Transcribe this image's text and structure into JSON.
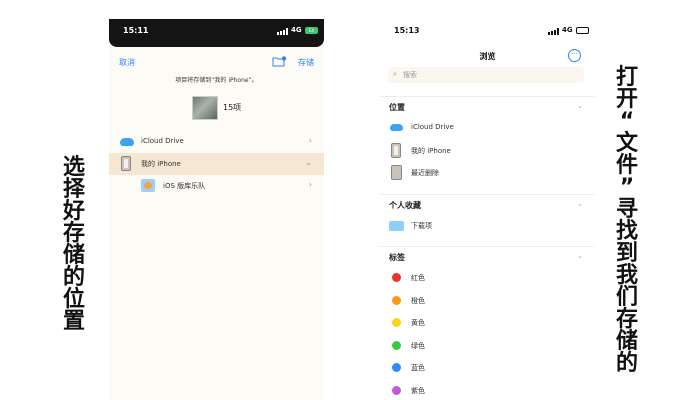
{
  "left_phone": {
    "status": {
      "time": "15:11",
      "network": "4G",
      "battery": "EX"
    },
    "nav": {
      "cancel": "取消",
      "save": "存储"
    },
    "hint": "项目将存储到“我的 iPhone”。",
    "item_count": "15项",
    "locations": [
      {
        "label": "iCloud Drive"
      },
      {
        "label": "我的 iPhone"
      },
      {
        "label": "iOS 版库乐队"
      }
    ]
  },
  "right_phone": {
    "status": {
      "time": "15:13",
      "network": "4G"
    },
    "title": "浏览",
    "more": "···",
    "search_placeholder": "搜索",
    "sections": {
      "locations": {
        "title": "位置",
        "items": [
          "iCloud Drive",
          "我的 iPhone",
          "最近删除"
        ]
      },
      "favorites": {
        "title": "个人收藏",
        "items": [
          "下载项"
        ]
      },
      "tags": {
        "title": "标签",
        "items": [
          {
            "label": "红色",
            "color": "#e8342b"
          },
          {
            "label": "橙色",
            "color": "#f59a1b"
          },
          {
            "label": "黄色",
            "color": "#f8d51c"
          },
          {
            "label": "绿色",
            "color": "#3cc846"
          },
          {
            "label": "蓝色",
            "color": "#2f8cf5"
          },
          {
            "label": "紫色",
            "color": "#c05ad9"
          }
        ]
      }
    }
  },
  "captions": {
    "left": [
      "选",
      "择",
      "好",
      "存",
      "储",
      "的",
      "位",
      "置"
    ],
    "right": [
      "打",
      "开",
      "“",
      "文",
      "件",
      "”",
      "寻",
      "找",
      "到",
      "我",
      "们",
      "存",
      "储",
      "的"
    ]
  }
}
